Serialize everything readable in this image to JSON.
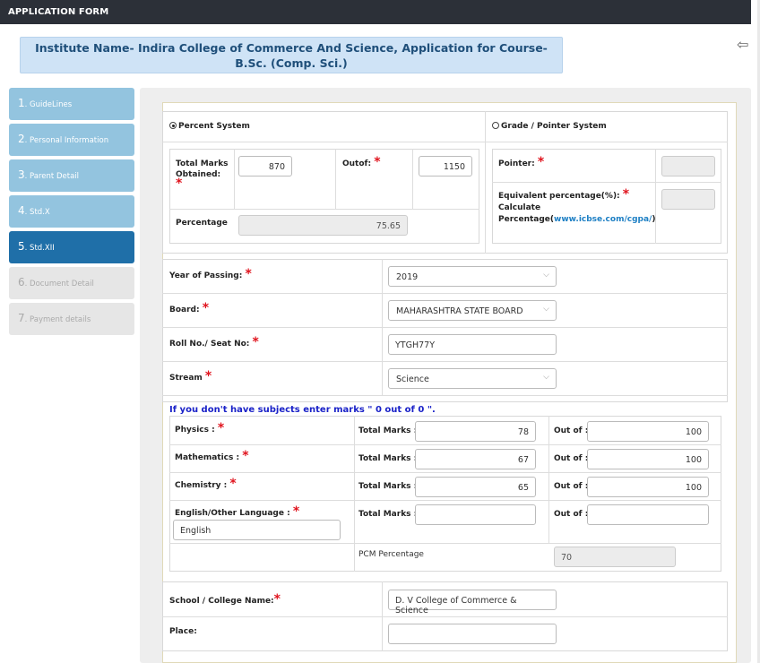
{
  "header": {
    "title": "APPLICATION FORM"
  },
  "institute": {
    "text": "Institute Name- Indira College of Commerce And Science, Application for Course- B.Sc. (Comp. Sci.)"
  },
  "steps": [
    {
      "num": "1",
      "label": ". GuideLines"
    },
    {
      "num": "2",
      "label": ". Personal Information"
    },
    {
      "num": "3",
      "label": ". Parent Detail"
    },
    {
      "num": "4",
      "label": ". Std.X"
    },
    {
      "num": "5",
      "label": ". Std.XII"
    },
    {
      "num": "6",
      "label": ". Document Detail"
    },
    {
      "num": "7",
      "label": ". Payment details"
    }
  ],
  "system": {
    "percent_label": "Percent System",
    "grade_label": "Grade / Pointer System",
    "total_marks_label": "Total Marks Obtained:",
    "total_marks_value": "870",
    "outof_label": "Outof:",
    "outof_value": "1150",
    "percentage_label": "Percentage",
    "percentage_value": "75.65",
    "pointer_label": "Pointer:",
    "equiv_label": "Equivalent percentage(%):",
    "calc_label": "Calculate Percentage(",
    "calc_link": "www.icbse.com/cgpa/",
    "calc_close": ")"
  },
  "form": {
    "year_label": "Year of Passing:",
    "year_value": "2019",
    "board_label": "Board:",
    "board_value": "MAHARASHTRA STATE BOARD",
    "roll_label": "Roll No./ Seat No:",
    "roll_value": "YTGH77Y",
    "stream_label": "Stream",
    "stream_value": "Science"
  },
  "subjects": {
    "note": "If you don't have subjects enter marks \" 0 out of 0 \".",
    "total_label": "Total Marks :",
    "outof_label": "Out of :",
    "rows": [
      {
        "name": "Physics :",
        "total": "78",
        "outof": "100"
      },
      {
        "name": "Mathematics :",
        "total": "67",
        "outof": "100"
      },
      {
        "name": "Chemistry :",
        "total": "65",
        "outof": "100"
      },
      {
        "name": "English/Other Language :",
        "total": "",
        "outof": "",
        "lang": "English"
      }
    ],
    "pcm_label": "PCM Percentage",
    "pcm_value": "70"
  },
  "school": {
    "name_label": "School / College Name:",
    "name_value": "D. V College of Commerce & Science",
    "place_label": "Place:",
    "place_value": ""
  }
}
